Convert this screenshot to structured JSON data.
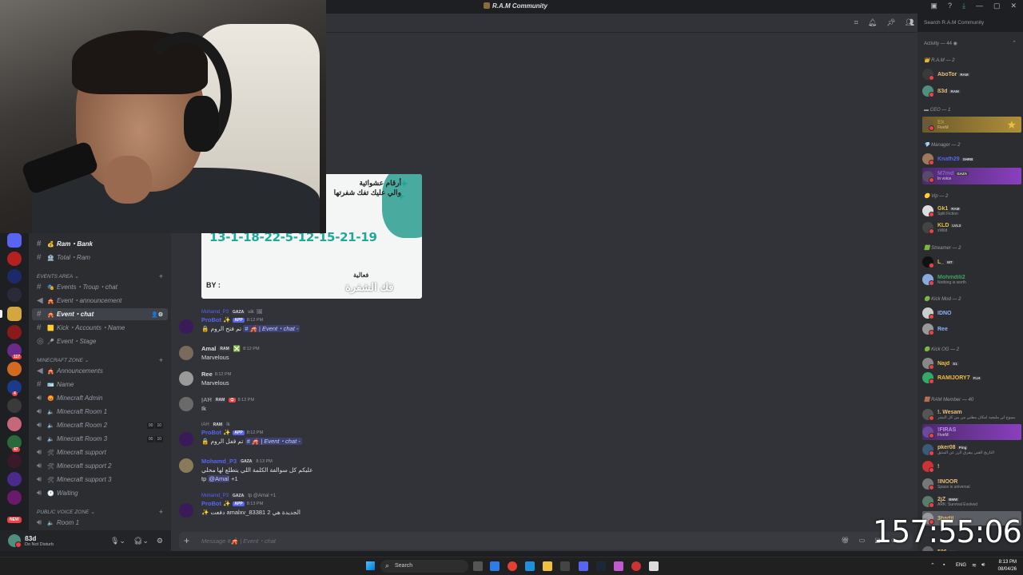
{
  "window": {
    "title": "R.A.M Community"
  },
  "header": {
    "search_placeholder": "Search R.A.M Community"
  },
  "sidebar": {
    "channels_top": [
      {
        "label": "Ram・Bank",
        "icon": "hash-icon",
        "emoji": "💰",
        "bold": true
      },
      {
        "label": "Total・Ram",
        "icon": "hash-icon",
        "emoji": "🏦",
        "bold": false
      }
    ],
    "categories": [
      {
        "label": "EVENTS AREA"
      },
      {
        "label": "MINECRAFT ZONE"
      },
      {
        "label": "PUBLIC VOICE ZONE"
      }
    ],
    "events": [
      {
        "label": "Events・Troup・chat",
        "icon": "hash-icon"
      },
      {
        "label": "Event・announcement",
        "icon": "megaphone-icon"
      },
      {
        "label": "Event・chat",
        "icon": "hash-icon",
        "active": true
      },
      {
        "label": "Kick・Accounts・Name",
        "icon": "hash-icon"
      },
      {
        "label": "Event・Stage",
        "icon": "stage-icon"
      }
    ],
    "minecraft": [
      {
        "label": "Announcements",
        "icon": "megaphone-icon"
      },
      {
        "label": "Name",
        "icon": "hash-icon"
      },
      {
        "label": "Minecraft Admin",
        "icon": "speaker-icon"
      },
      {
        "label": "Minecraft Room 1",
        "icon": "speaker-icon"
      },
      {
        "label": "Minecraft Room 2",
        "icon": "speaker-icon",
        "counts": [
          "00",
          "10"
        ]
      },
      {
        "label": "Minecraft Room 3",
        "icon": "speaker-icon",
        "counts": [
          "00",
          "10"
        ]
      },
      {
        "label": "Minecraft support",
        "icon": "speaker-icon"
      },
      {
        "label": "Minecraft support 2",
        "icon": "speaker-icon"
      },
      {
        "label": "Minecraft support 3",
        "icon": "speaker-icon"
      },
      {
        "label": "Waiting",
        "icon": "speaker-icon"
      }
    ],
    "public_voice": [
      {
        "label": "Room 1",
        "icon": "speaker-icon"
      }
    ],
    "rail_badges": [
      "117",
      "4",
      "47"
    ],
    "rail_new": "NEW"
  },
  "user_panel": {
    "name": "ß3d",
    "status": "Do Not Disturb"
  },
  "card": {
    "line1": "أرقام عشوائية",
    "line2": "والي عليك تفك شفرتها",
    "code": "13-1-18-22-5-12-15-21-19",
    "by": "BY :",
    "footer1": "فعالية",
    "footer2": "فك الشفرة"
  },
  "messages": [
    {
      "reply": {
        "name": "Mohamd_P3",
        "tag": "GAZA",
        "text": "uik"
      },
      "name": "ProBot ✨",
      "app": "APP",
      "time": "8:12 PM",
      "body_prefix": "🔒 تم فتح الروم",
      "channel": "# 🎪 | Event・chat -",
      "avatar_color": "#3b1a5a",
      "name_color": "#5865f2"
    },
    {
      "name": "Amal",
      "role": "RAM",
      "time": "8:12 PM",
      "body": "Marvelous",
      "avatar_color": "#7a6a5a",
      "name_color": "#f2f3f5"
    },
    {
      "name": "Ree",
      "role": "",
      "time": "8:12 PM",
      "body": "Marvelous",
      "avatar_color": "#9a9a9a",
      "name_color": "#f2f3f5"
    },
    {
      "name": "ĮAĦ",
      "role": "RAM",
      "time": "8:12 PM",
      "body": "Ik",
      "avatar_color": "#6a6a6a",
      "name_color": "#8a8f98"
    },
    {
      "reply": {
        "name": "iAH",
        "tag": "RAM",
        "text": "Ik"
      },
      "name": "ProBot ✨",
      "app": "APP",
      "time": "8:12 PM",
      "body_prefix": "🔒 تم قفل الروم",
      "channel": "# 🎪 | Event・chat -",
      "avatar_color": "#3b1a5a",
      "name_color": "#5865f2"
    },
    {
      "name": "Mohamd_P3",
      "role": "GAZA",
      "time": "8:13 PM",
      "body": "عليكم كل سوالفة الكلمة اللي يتطلع لها محلي",
      "body2_prefix": "tp",
      "mention": "@Amal",
      "body2_suffix": "+1",
      "avatar_color": "#8a7a5a",
      "name_color": "#5865f2"
    },
    {
      "reply": {
        "name": "Mohamd_P3",
        "tag": "GAZA",
        "text": "tp @Amal +1"
      },
      "name": "ProBot ✨",
      "app": "APP",
      "time": "8:13 PM",
      "body": "✨ دفعت amalxv_83381 الجديدة هي 2",
      "avatar_color": "#3b1a5a",
      "name_color": "#5865f2"
    }
  ],
  "composer": {
    "placeholder": "Message #🎪 | Event・chat"
  },
  "members": {
    "activity": "Activity — 44",
    "groups": [
      {
        "label": "R.A.M — 2"
      },
      {
        "label": "CEO — 1"
      },
      {
        "label": "Manager — 2"
      },
      {
        "label": "Vip — 2"
      },
      {
        "label": "Streamer — 2"
      },
      {
        "label": "Kick Mod — 2"
      },
      {
        "label": "Kick OG — 2"
      },
      {
        "label": "RAM Member — 40"
      }
    ],
    "list": [
      {
        "name": "AboTor",
        "tag": "RAM",
        "sub": "",
        "color": "#e8c07a",
        "av": "#3a3a3a"
      },
      {
        "name": "ß3d",
        "tag": "RAM",
        "sub": "",
        "color": "#e8c07a",
        "av": "#4f8f7f"
      },
      {
        "name": "Ek",
        "tag": "",
        "sub": "FiveM",
        "color": "#b08f3a",
        "av": "#6a5a3a",
        "hl": "gold"
      },
      {
        "name": "Knafh29",
        "tag": "SHRB",
        "sub": "",
        "color": "#5865f2",
        "av": "#a0785a"
      },
      {
        "name": "M7md",
        "tag": "GAZA",
        "sub": "In voice",
        "color": "#8a5fd0",
        "av": "#5a4a6a",
        "hl": "purple"
      },
      {
        "name": "Gk1",
        "tag": "RAM",
        "sub": "Split Fiction",
        "color": "#f0c040",
        "av": "#ddd"
      },
      {
        "name": "KLD",
        "tag": "LVL3",
        "sub": "xWild",
        "color": "#f0c040",
        "av": "#444"
      },
      {
        "name": "L_",
        "tag": "MT",
        "sub": "",
        "color": "#f0c040",
        "av": "#111"
      },
      {
        "name": "Mohmdili2",
        "tag": "",
        "sub": "Nothing is worth",
        "color": "#3ba55c",
        "av": "#8ad"
      },
      {
        "name": "IDNO",
        "tag": "",
        "sub": "",
        "color": "#8ab4f8",
        "av": "#ccc"
      },
      {
        "name": "Ree",
        "tag": "",
        "sub": "",
        "color": "#8ab4f8",
        "av": "#999"
      },
      {
        "name": "Najd",
        "tag": "S1",
        "sub": "",
        "color": "#f0c040",
        "av": "#888"
      },
      {
        "name": "RAMIJORY7",
        "tag": "FLH",
        "sub": "",
        "color": "#f0c040",
        "av": "#3a6"
      },
      {
        "name": "!. Wesam",
        "tag": "",
        "sub": "يسوح لي مليجيه امكان مطني من بين كل البشر",
        "color": "#e8c07a",
        "av": "#555"
      },
      {
        "name": "!FIRAS",
        "tag": "",
        "sub": "FiveM",
        "color": "#c28af0",
        "av": "#6a4a9a",
        "hl": "purple"
      },
      {
        "name": "pker08",
        "tag": "Ping",
        "sub": "التاريخ الفنى بيفرق الرز عن المنتق",
        "color": "#e8c07a",
        "av": "#3a5a7a"
      },
      {
        "name": "! ",
        "tag": "",
        "sub": "",
        "color": "#e8c07a",
        "av": "#c33"
      },
      {
        "name": "!INOOR",
        "tag": "",
        "sub": "Space is universal",
        "color": "#e8c07a",
        "av": "#777"
      },
      {
        "name": "2jZ",
        "tag": "BMW",
        "sub": "ARK: Survival Evolved",
        "color": "#e8c07a",
        "av": "#5a7a6a"
      },
      {
        "name": "3hadil",
        "tag": "",
        "sub": "",
        "color": "#e8c07a",
        "av": "#999",
        "hl": "grey"
      },
      {
        "name": "506",
        "tag": "NQ",
        "sub": "",
        "color": "#e8c07a",
        "av": "#666"
      }
    ]
  },
  "timer": "157:55:06",
  "taskbar": {
    "search": "Search",
    "lang": "ENG",
    "time": "8:13 PM",
    "date": "08/04/26"
  },
  "colors": {
    "bg": "#313338",
    "sidebar": "#2b2d31",
    "rail": "#1e1f22",
    "accent": "#5865f2",
    "card_teal": "#1fa89a"
  }
}
